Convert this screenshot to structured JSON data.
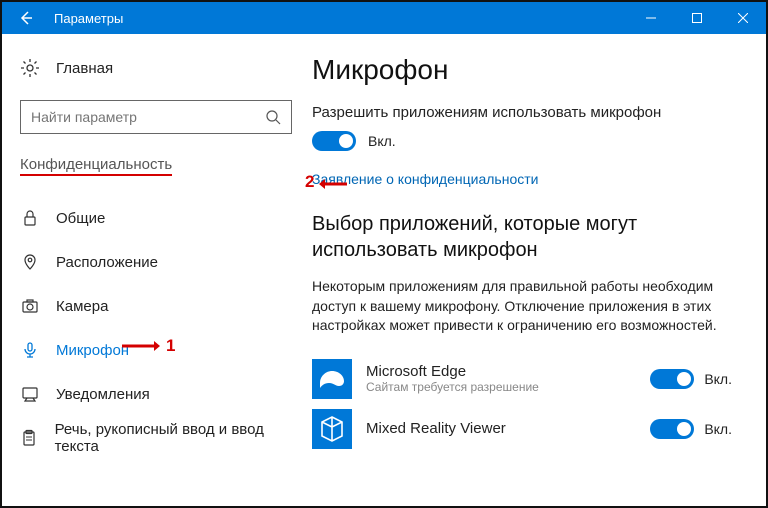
{
  "titlebar": {
    "title": "Параметры"
  },
  "sidebar": {
    "home_label": "Главная",
    "search_placeholder": "Найти параметр",
    "section_title": "Конфиденциальность",
    "items": [
      {
        "label": "Общие"
      },
      {
        "label": "Расположение"
      },
      {
        "label": "Камера"
      },
      {
        "label": "Микрофон"
      },
      {
        "label": "Уведомления"
      },
      {
        "label": "Речь, рукописный ввод и ввод текста"
      }
    ]
  },
  "main": {
    "page_title": "Микрофон",
    "allow_label": "Разрешить приложениям использовать микрофон",
    "allow_state": "Вкл.",
    "privacy_link": "Заявление о конфиденциальности",
    "apps_section_title": "Выбор приложений, которые могут использовать микрофон",
    "apps_section_desc": "Некоторым приложениям для правильной работы необходим доступ к вашему микрофону. Отключение приложения в этих настройках может привести к ограничению его возможностей.",
    "apps": [
      {
        "name": "Microsoft Edge",
        "sub": "Сайтам требуется разрешение",
        "state": "Вкл."
      },
      {
        "name": "Mixed Reality Viewer",
        "sub": "",
        "state": "Вкл."
      }
    ]
  },
  "annotations": {
    "one": "1",
    "two": "2"
  },
  "colors": {
    "accent": "#0078d7",
    "red": "#d40000"
  }
}
